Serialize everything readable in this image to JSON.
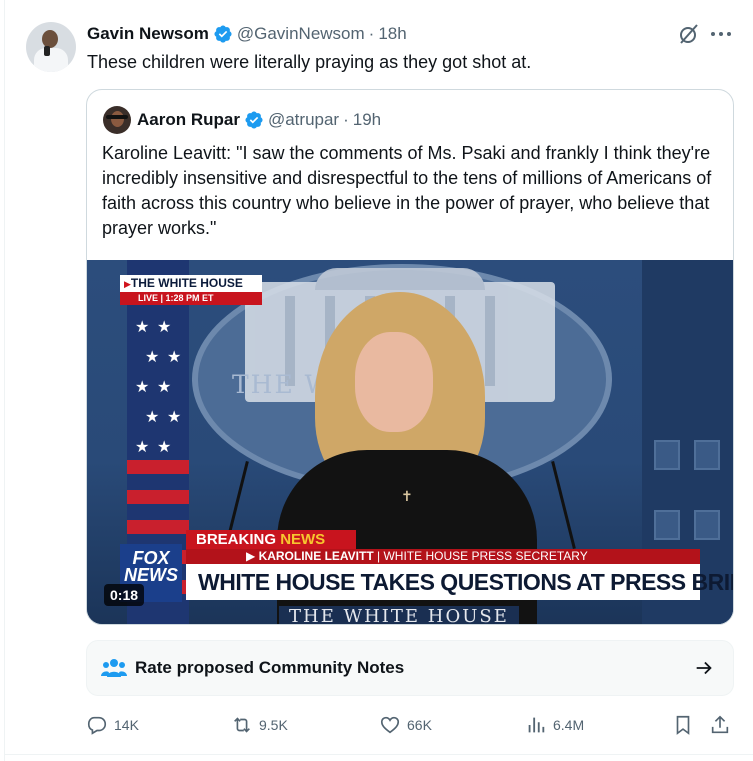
{
  "tweet": {
    "author_name": "Gavin Newsom",
    "author_handle": "@GavinNewsom",
    "separator": "·",
    "time": "18h",
    "text": "These children were literally praying as they got shot at."
  },
  "quote": {
    "author_name": "Aaron Rupar",
    "author_handle": "@atrupar",
    "separator": "·",
    "time": "19h",
    "text": "Karoline Leavitt: \"I saw the comments of Ms. Psaki and frankly I think they're incredibly insensitive and disrespectful to the tens of millions of Americans of faith across this country who believe in the power of prayer, who believe that prayer works.\""
  },
  "video": {
    "bug_title": "THE WHITE HOUSE",
    "bug_live": "LIVE | 1:28 PM ET",
    "background_text": "THE WH USE",
    "breaking_label": "BREAKING",
    "breaking_news": "NEWS",
    "strap_name": "KAROLINE LEAVITT",
    "strap_title": "| WHITE HOUSE PRESS SECRETARY",
    "headline": "WHITE HOUSE TAKES QUESTIONS AT PRESS BRIEFING",
    "podium_text": "THE WHITE HOUSE",
    "logo_text": "FOX NEWS",
    "duration": "0:18"
  },
  "community_notes": {
    "label": "Rate proposed Community Notes"
  },
  "actions": {
    "replies": "14K",
    "reposts": "9.5K",
    "likes": "66K",
    "views": "6.4M"
  },
  "colors": {
    "verified_blue": "#1d9bf0",
    "secondary_text": "#536471",
    "breaking_red": "#c8141e",
    "news_yellow": "#f7c62f"
  },
  "icons": [
    "verified-icon",
    "grok-icon",
    "more-icon",
    "community-notes-icon",
    "arrow-right-icon",
    "reply-icon",
    "repost-icon",
    "like-icon",
    "views-icon",
    "bookmark-icon",
    "share-icon"
  ]
}
